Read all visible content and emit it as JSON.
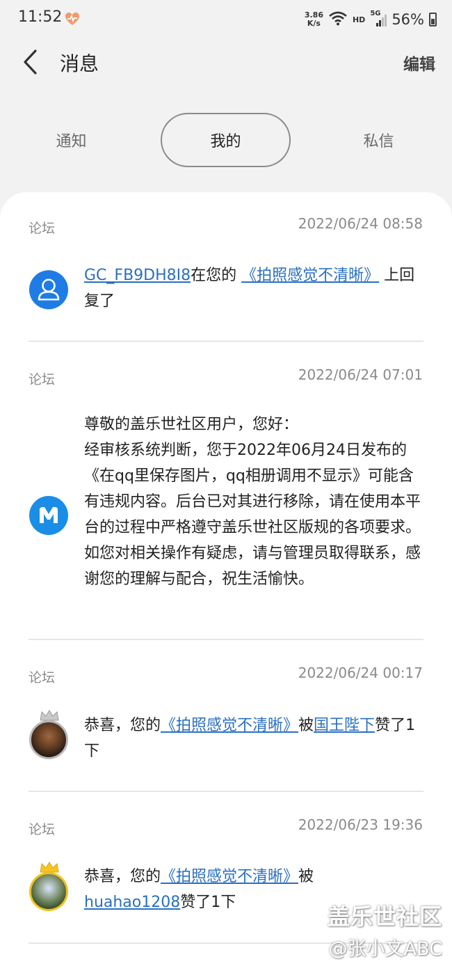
{
  "status_bar": {
    "time": "11:52",
    "net_speed_value": "3.86",
    "net_speed_unit": "K/s",
    "hd": "HD",
    "signal": "5G",
    "battery": "56%"
  },
  "header": {
    "title": "消息",
    "edit_label": "编辑"
  },
  "tabs": {
    "notice": "通知",
    "mine": "我的",
    "dm": "私信"
  },
  "messages": [
    {
      "category": "论坛",
      "time": "2022/06/24 08:58",
      "user": "GC_FB9DH8I8",
      "t1": "在您的",
      "post": "《拍照感觉不清晰》",
      "t2": "上回复了"
    },
    {
      "category": "论坛",
      "time": "2022/06/24 07:01",
      "l1": "尊敬的盖乐世社区用户，您好：",
      "l2": "经审核系统判断，您于2022年06月24日发布的《在qq里保存图片，qq相册调用不显示》可能含有违规内容。后台已对其进行移除，请在使用本平台的过程中严格遵守盖乐世社区版规的各项要求。",
      "l3": "如您对相关操作有疑虑，请与管理员取得联系，感谢您的理解与配合，祝生活愉快。"
    },
    {
      "category": "论坛",
      "time": "2022/06/24 00:17",
      "t1": "恭喜，您的",
      "post": "《拍照感觉不清晰》",
      "t2": "被",
      "user": "国王陛下",
      "t3": "赞了1下"
    },
    {
      "category": "论坛",
      "time": "2022/06/23 19:36",
      "t1": "恭喜，您的",
      "post": "《拍照感觉不清晰》",
      "t2": "被",
      "user": "huahao1208",
      "t3": "赞了1下"
    }
  ],
  "watermark": {
    "line1": "盖乐世社区",
    "line2": "@张小文ABC"
  }
}
